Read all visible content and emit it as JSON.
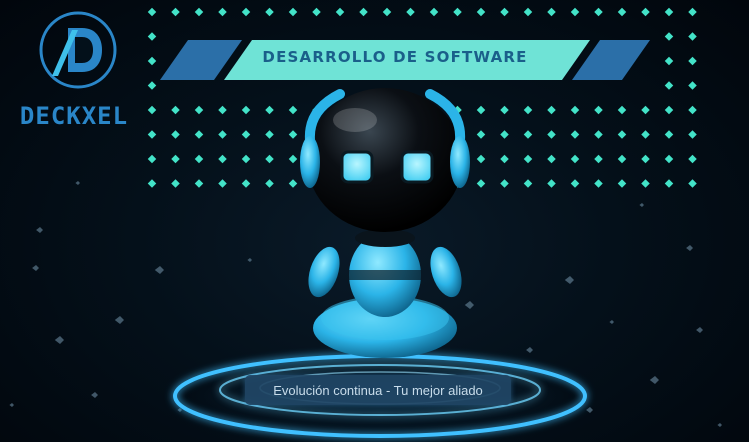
{
  "brand": {
    "name": "DECKXEL",
    "primary_color": "#2a86c8",
    "accent_color": "#3fc0ea"
  },
  "banner": {
    "text": "DESARROLLO DE SOFTWARE",
    "bg_color": "#6fe3d6",
    "side_color": "#2b6fa8"
  },
  "tagline": {
    "text": "Evolución continua - Tu mejor aliado"
  },
  "decor": {
    "dot_color": "#43e3c8",
    "glow_color": "#3fc0ff",
    "icons": [
      "deckxel-logo-icon",
      "robot-mascot-illustration",
      "glowing-platform-ring"
    ]
  }
}
